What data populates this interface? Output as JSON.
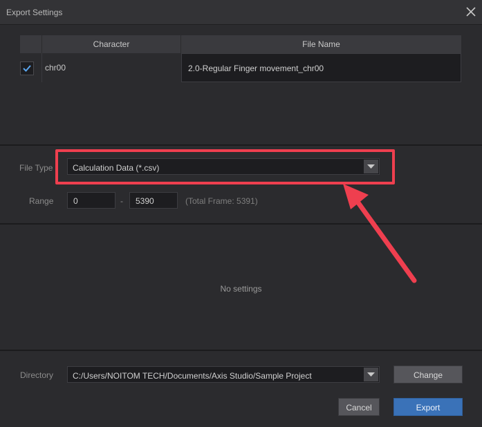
{
  "window": {
    "title": "Export Settings"
  },
  "table": {
    "headers": {
      "character": "Character",
      "file_name": "File Name"
    },
    "rows": [
      {
        "checked": true,
        "character": "chr00",
        "file_name": "2.0-Regular Finger movement_chr00"
      }
    ]
  },
  "file_type": {
    "label": "File Type",
    "value": "Calculation Data (*.csv)"
  },
  "range": {
    "label": "Range",
    "start": "0",
    "separator": "-",
    "end": "5390",
    "total": "(Total Frame: 5391)"
  },
  "settings": {
    "empty_text": "No settings"
  },
  "directory": {
    "label": "Directory",
    "value": "C:/Users/NOITOM TECH/Documents/Axis Studio/Sample Project",
    "change_label": "Change"
  },
  "actions": {
    "cancel_label": "Cancel",
    "export_label": "Export"
  },
  "colors": {
    "highlight": "#ef3f4f",
    "accent": "#3a72b8",
    "checkmark": "#5aa6f0"
  }
}
